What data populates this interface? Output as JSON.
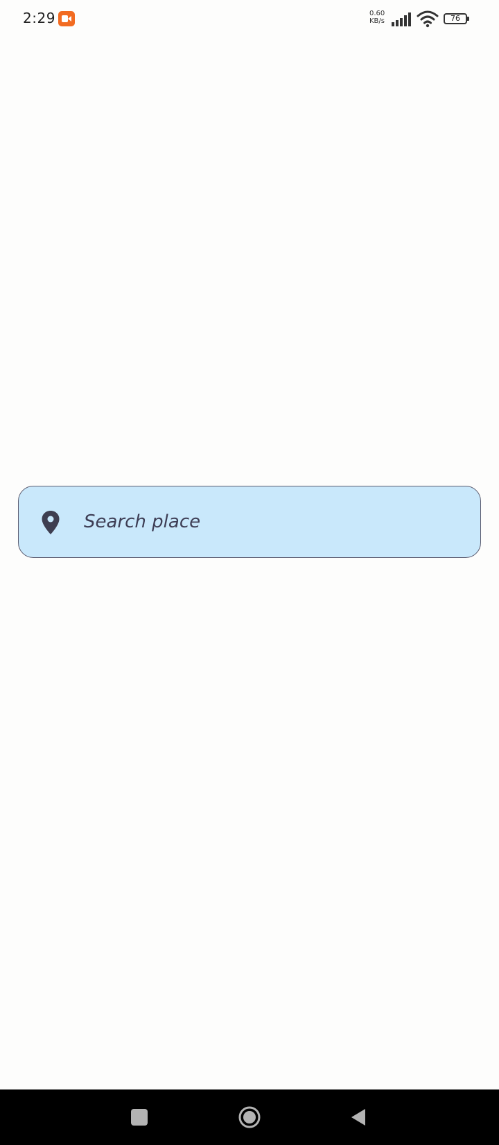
{
  "status_bar": {
    "time": "2:29",
    "net_speed_value": "0.60",
    "net_speed_unit": "KB/s",
    "battery_level": "76",
    "icons": [
      "screen-recorder-icon",
      "signal-icon",
      "wifi-icon",
      "battery-icon"
    ]
  },
  "search": {
    "label": "Search place",
    "icon": "location-pin-icon"
  },
  "nav_bar": {
    "icons": [
      "recents-icon",
      "home-icon",
      "back-icon"
    ]
  },
  "colors": {
    "background": "#fdfdfc",
    "search_fill": "#c9e8fb",
    "search_border": "#5a5a6e",
    "text": "#3e3e55",
    "recorder_orange": "#f26b21",
    "nav_bar": "#000000"
  }
}
